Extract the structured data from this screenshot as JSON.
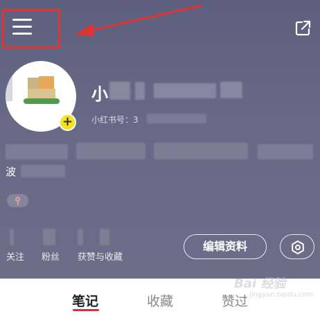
{
  "header": {
    "menu_icon": "hamburger-menu-icon",
    "share_icon": "share-external-icon",
    "annotation_color": "#e23232"
  },
  "profile": {
    "plus_badge": "+",
    "nickname": "小",
    "id_label": "小红书号：3",
    "bio_char": "波",
    "gender_icon": "female-icon"
  },
  "stats": {
    "following_label": "关注",
    "fans_label": "粉丝",
    "likes_label": "获赞与收藏"
  },
  "actions": {
    "edit_profile": "编辑资料",
    "settings_icon": "gear-icon"
  },
  "tabs": [
    {
      "label": "笔记",
      "active": true
    },
    {
      "label": "收藏",
      "active": false
    },
    {
      "label": "赞过",
      "active": false
    }
  ],
  "watermark": {
    "text": "Bai 经验",
    "sub": "jingyan.baidu.com"
  },
  "colors": {
    "header_bg": "#5c607e",
    "accent": "#e8293b",
    "badge": "#f7e11c"
  }
}
